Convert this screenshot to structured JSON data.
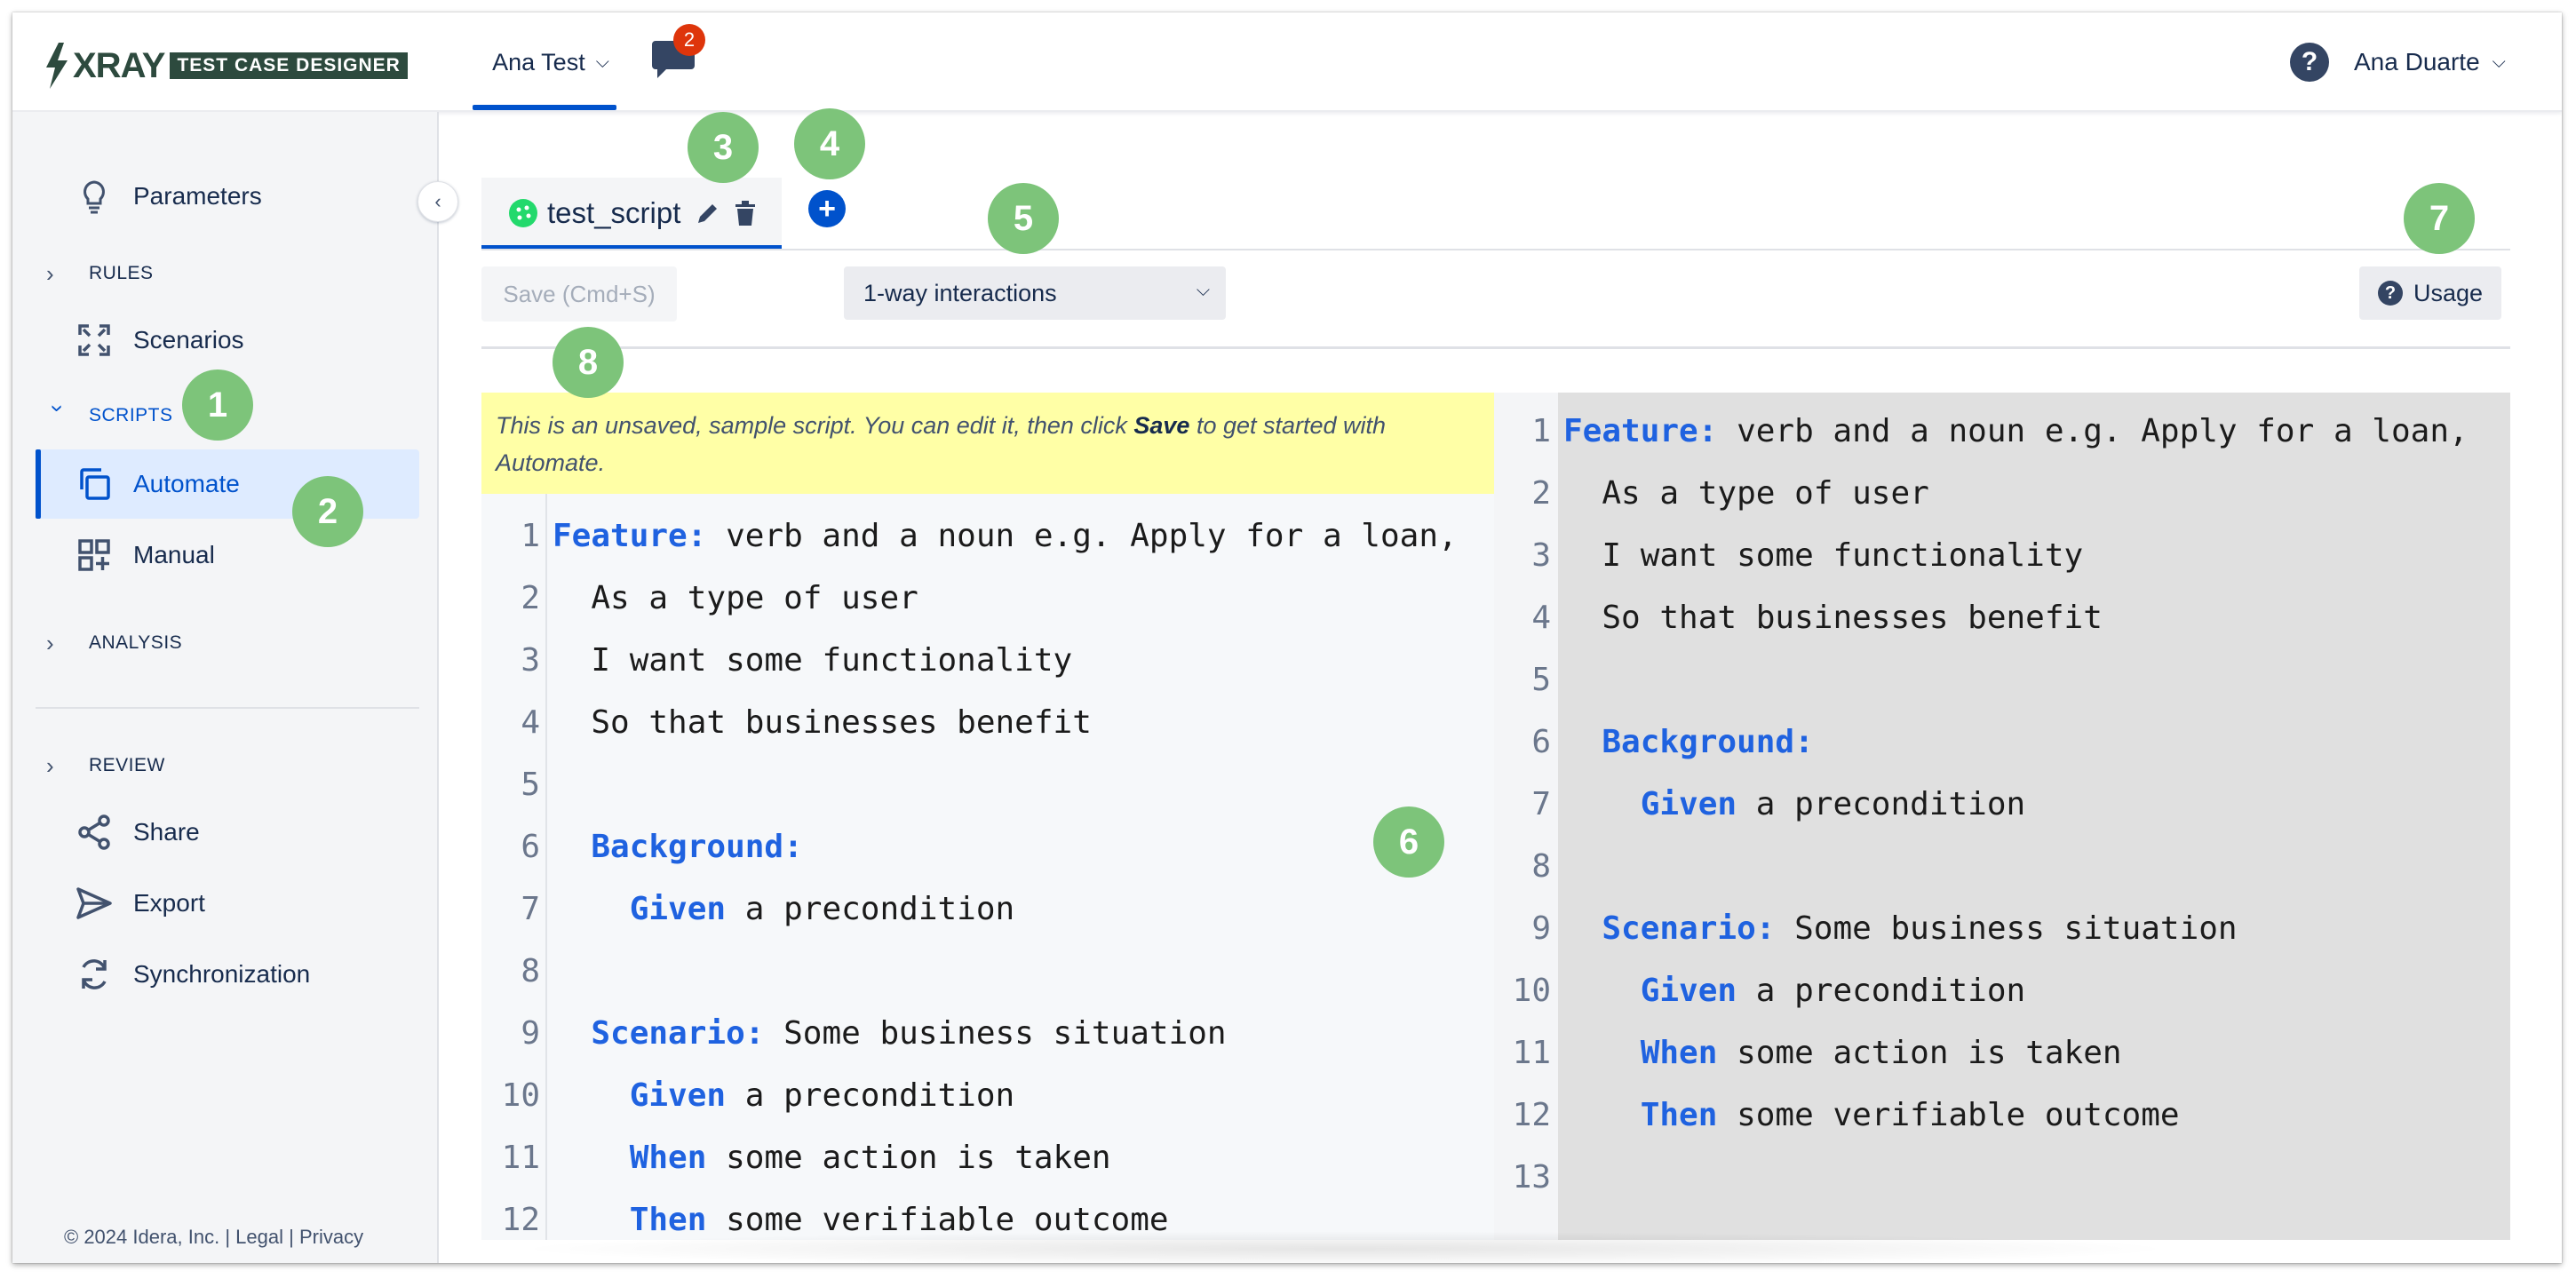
{
  "app": {
    "brand": "XRAY",
    "product": "TEST CASE DESIGNER"
  },
  "topbar": {
    "project": "Ana Test",
    "chat_count": "2",
    "user": "Ana Duarte"
  },
  "sidebar": {
    "parameters": "Parameters",
    "rules": "RULES",
    "scenarios": "Scenarios",
    "scripts": "SCRIPTS",
    "automate": "Automate",
    "manual": "Manual",
    "analysis": "ANALYSIS",
    "review": "REVIEW",
    "share": "Share",
    "export": "Export",
    "synchronization": "Synchronization",
    "footer_copyright": "© 2024 Idera, Inc. | ",
    "footer_legal": "Legal",
    "footer_sep": " | ",
    "footer_privacy": "Privacy"
  },
  "callouts": [
    "1",
    "2",
    "3",
    "4",
    "5",
    "6",
    "7",
    "8"
  ],
  "tab": {
    "name": "test_script"
  },
  "toolbar": {
    "save": "Save (Cmd+S)",
    "interactions": "1-way interactions",
    "usage": "Usage"
  },
  "notice": {
    "prefix": "This is an unsaved, sample script. You can edit it, then click ",
    "bold": "Save",
    "suffix": " to get started with Automate."
  },
  "editor_left": {
    "lines": [
      {
        "n": "1",
        "indent": "",
        "kw": "Feature:",
        "text": " verb and a noun e.g. Apply for a loan,"
      },
      {
        "n": "2",
        "indent": "  ",
        "kw": "",
        "text": "As a type of user"
      },
      {
        "n": "3",
        "indent": "  ",
        "kw": "",
        "text": "I want some functionality"
      },
      {
        "n": "4",
        "indent": "  ",
        "kw": "",
        "text": "So that businesses benefit"
      },
      {
        "n": "5",
        "indent": "",
        "kw": "",
        "text": ""
      },
      {
        "n": "6",
        "indent": "  ",
        "kw": "Background:",
        "text": ""
      },
      {
        "n": "7",
        "indent": "    ",
        "kw": "Given",
        "text": " a precondition"
      },
      {
        "n": "8",
        "indent": "",
        "kw": "",
        "text": ""
      },
      {
        "n": "9",
        "indent": "  ",
        "kw": "Scenario:",
        "text": " Some business situation"
      },
      {
        "n": "10",
        "indent": "    ",
        "kw": "Given",
        "text": " a precondition"
      },
      {
        "n": "11",
        "indent": "    ",
        "kw": "When",
        "text": " some action is taken"
      },
      {
        "n": "12",
        "indent": "    ",
        "kw": "Then",
        "text": " some verifiable outcome"
      }
    ]
  },
  "editor_right": {
    "lines": [
      {
        "n": "1",
        "indent": "",
        "kw": "Feature:",
        "text": " verb and a noun e.g. Apply for a loan,"
      },
      {
        "n": "2",
        "indent": "  ",
        "kw": "",
        "text": "As a type of user"
      },
      {
        "n": "3",
        "indent": "  ",
        "kw": "",
        "text": "I want some functionality"
      },
      {
        "n": "4",
        "indent": "  ",
        "kw": "",
        "text": "So that businesses benefit"
      },
      {
        "n": "5",
        "indent": "",
        "kw": "",
        "text": ""
      },
      {
        "n": "6",
        "indent": "  ",
        "kw": "Background:",
        "text": ""
      },
      {
        "n": "7",
        "indent": "    ",
        "kw": "Given",
        "text": " a precondition"
      },
      {
        "n": "8",
        "indent": "",
        "kw": "",
        "text": ""
      },
      {
        "n": "9",
        "indent": "  ",
        "kw": "Scenario:",
        "text": " Some business situation"
      },
      {
        "n": "10",
        "indent": "    ",
        "kw": "Given",
        "text": " a precondition"
      },
      {
        "n": "11",
        "indent": "    ",
        "kw": "When",
        "text": " some action is taken"
      },
      {
        "n": "12",
        "indent": "    ",
        "kw": "Then",
        "text": " some verifiable outcome"
      },
      {
        "n": "13",
        "indent": "",
        "kw": "",
        "text": ""
      }
    ]
  },
  "colors": {
    "accent": "#0052cc",
    "keyword": "#1f62e0",
    "callout": "#7dc47a",
    "notice": "#ffffa6",
    "badge": "#de350b"
  }
}
